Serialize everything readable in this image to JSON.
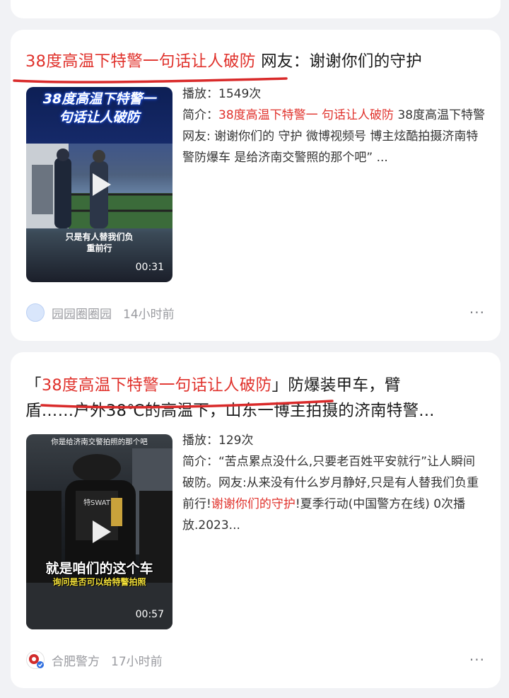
{
  "cards": [
    {
      "title_highlight": "38度高温下特警一句话让人破防",
      "title_rest": " 网友：谢谢你们的守护",
      "thumbnail": {
        "caption_line1": "38度高温下特警一",
        "caption_line2": "句话让人破防",
        "subtitle_line1": "只是有人替我们负",
        "subtitle_line2": "重前行",
        "duration": "00:31"
      },
      "plays": "播放：1549次",
      "desc_prefix": "简介：",
      "desc_highlight": "38度高温下特警一 句话让人破防",
      "desc_rest": " 38度高温下特警 网友: 谢谢你们的 守护 微博视频号 博主炫酷拍摄济南特警防爆车 是给济南交警照的那个吧” ...",
      "author": "园园圈圈园",
      "time": "14小时前",
      "more": "···"
    },
    {
      "title_prefix": "「",
      "title_highlight": "38度高温下特警一句话让人破防",
      "title_rest": "」防爆装甲车，臂",
      "title_line2": "盾……户外38℃的高温下，山东一博主拍摄的济南特警...",
      "thumbnail": {
        "topbar": "你是给济南交警拍照的那个吧",
        "caption_big": "就是咱们的这个车",
        "caption_yellow": "询问是否可以给特警拍照",
        "duration": "00:57"
      },
      "plays": "播放：129次",
      "desc_prefix": "简介：“苦点累点没什么,只要老百姓平安就行”让人瞬间破防。网友:从来没有什么岁月静好,只是有人替我们负重前行!",
      "desc_highlight": "谢谢你们的守护",
      "desc_rest": "!夏季行动(中国警方在线) 0次播放.2023...",
      "author": "合肥警方",
      "time": "17小时前",
      "more": "···"
    }
  ],
  "colors": {
    "highlight": "#e0312b",
    "background": "#f1f2f5",
    "card": "#ffffff",
    "muted": "#9a9ba0"
  }
}
